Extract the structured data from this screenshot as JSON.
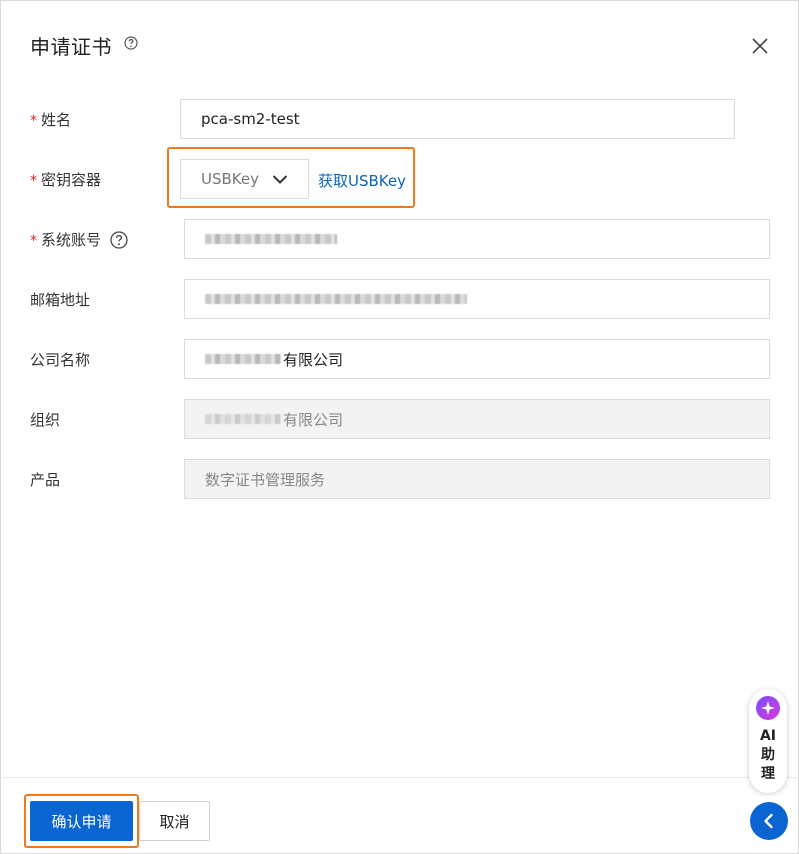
{
  "dialog": {
    "title": "申请证书",
    "title_help_icon": "question-circle-icon",
    "close_icon": "close-icon"
  },
  "form": {
    "required_mark": "*",
    "name": {
      "label": "姓名",
      "value": "pca-sm2-test",
      "required": true
    },
    "key_container": {
      "label": "密钥容器",
      "selected": "USBKey",
      "link": "获取USBKey",
      "required": true
    },
    "system_account": {
      "label": "系统账号",
      "required": true,
      "value_redacted": true
    },
    "email": {
      "label": "邮箱地址",
      "value_redacted": true
    },
    "company": {
      "label": "公司名称",
      "value_suffix": "有限公司"
    },
    "organization": {
      "label": "组织",
      "value_suffix": "有限公司",
      "disabled": true
    },
    "product": {
      "label": "产品",
      "value": "数字证书管理服务",
      "disabled": true
    }
  },
  "footer": {
    "confirm_label": "确认申请",
    "cancel_label": "取消"
  },
  "assistant": {
    "label_line1": "AI",
    "label_line2": "助",
    "label_line3": "理"
  },
  "colors": {
    "primary": "#0a64d2",
    "link": "#0a64b8",
    "highlight": "#f07a1b",
    "required": "#e2231a"
  }
}
